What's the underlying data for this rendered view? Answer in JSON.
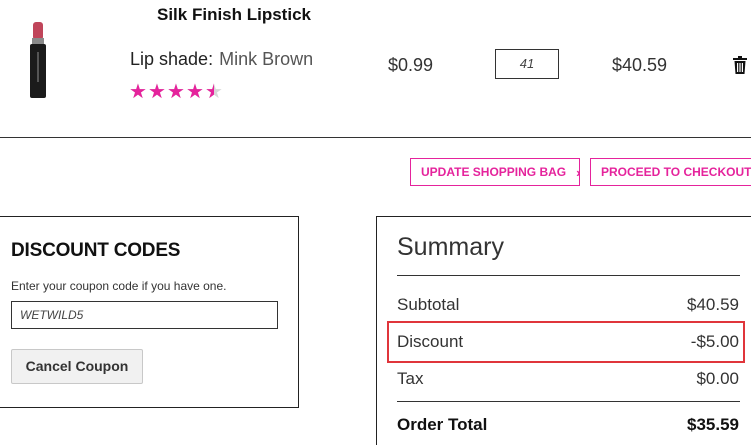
{
  "product": {
    "name": "Silk Finish Lipstick",
    "shade_label": "Lip shade:",
    "shade_value": "Mink Brown",
    "rating": 4.5,
    "rating_max": 5,
    "price": "$0.99",
    "quantity": "41",
    "row_total": "$40.59"
  },
  "actions": {
    "update_label": "UPDATE SHOPPING BAG",
    "checkout_label": "PROCEED TO CHECKOUT"
  },
  "discount": {
    "title": "DISCOUNT CODES",
    "help_text": "Enter your coupon code if you have one.",
    "coupon_value": "WETWILD5",
    "cancel_label": "Cancel Coupon"
  },
  "summary": {
    "title": "Summary",
    "rows": [
      {
        "label": "Subtotal",
        "value": "$40.59"
      },
      {
        "label": "Discount",
        "value": "-$5.00"
      },
      {
        "label": "Tax",
        "value": "$0.00"
      }
    ],
    "total_label": "Order Total",
    "total_value": "$35.59"
  },
  "colors": {
    "accent": "#e5239c",
    "highlight": "#e0353b",
    "lipstick": "#c0455a"
  },
  "icons": {
    "trash": "trash-icon",
    "chevron": "chevron-right-icon",
    "star": "star-icon"
  }
}
